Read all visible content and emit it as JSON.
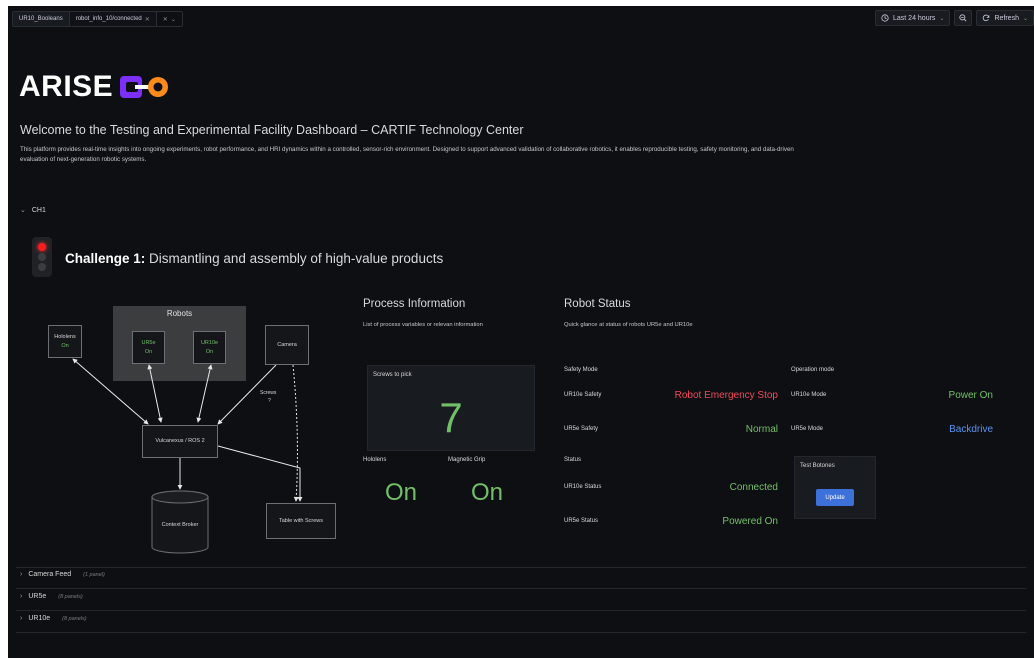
{
  "topbar": {
    "variables": [
      "UR10_Booleans",
      "robot_info_10/connected"
    ],
    "time_range": "Last 24 hours",
    "refresh_label": "Refresh"
  },
  "hero": {
    "logo_text": "ARISE",
    "welcome": "Welcome to the Testing and Experimental Facility Dashboard – CARTIF Technology Center",
    "description": "This platform provides real-time insights into ongoing experiments, robot performance, and HRI dynamics within a controlled, sensor-rich environment. Designed to support advanced validation of collaborative robotics, it enables reproducible testing, safety monitoring, and data-driven evaluation of next-generation robotic systems."
  },
  "rows": {
    "ch1": "CH1",
    "camera_feed": {
      "title": "Camera Feed",
      "meta": "(1 panel)"
    },
    "ur5e": {
      "title": "UR5e",
      "meta": "(8 panels)"
    },
    "ur10e": {
      "title": "UR10e",
      "meta": "(8 panels)"
    }
  },
  "challenge": {
    "prefix": "Challenge 1:",
    "title": "Dismantling and assembly of high-value products"
  },
  "diagram": {
    "robots_group": "Robots",
    "hololens": {
      "name": "Hololens",
      "state": "On"
    },
    "ur5e": {
      "name": "UR5e",
      "state": "On"
    },
    "ur10e": {
      "name": "UR10e",
      "state": "On"
    },
    "camera": "Camera",
    "vulcanexus": "Vulcanexus / ROS 2",
    "context_broker": "Context Broker",
    "table": "Table with Screws",
    "screws_label": "Screws",
    "screws_q": "?"
  },
  "process": {
    "title": "Process Information",
    "subtitle": "List of process variables or relevan information",
    "screws_title": "Screws to pick",
    "screws_value": "7",
    "hololens_label": "Hololens",
    "hololens_value": "On",
    "grip_label": "Magnetic Grip",
    "grip_value": "On"
  },
  "robot_status": {
    "title": "Robot Status",
    "subtitle": "Quick glance at status of robots UR5e and UR10e",
    "safety_header": "Safety Mode",
    "ur10e_safety_label": "UR10e Safety",
    "ur10e_safety_value": "Robot Emergency Stop",
    "ur5e_safety_label": "UR5e Safety",
    "ur5e_safety_value": "Normal",
    "status_header": "Status",
    "ur10e_status_label": "UR10e Status",
    "ur10e_status_value": "Connected",
    "ur5e_status_label": "UR5e Status",
    "ur5e_status_value": "Powered On",
    "operation_header": "Operation mode",
    "ur10e_mode_label": "UR10e Mode",
    "ur10e_mode_value": "Power On",
    "ur5e_mode_label": "UR5e Mode",
    "ur5e_mode_value": "Backdrive",
    "test_title": "Test Botones",
    "update_label": "Update"
  },
  "colors": {
    "green": "#73bf69",
    "red": "#f2495c",
    "blue": "#5794f2",
    "logo_purple": "#7b2ff7",
    "logo_orange": "#ff8c1a"
  }
}
